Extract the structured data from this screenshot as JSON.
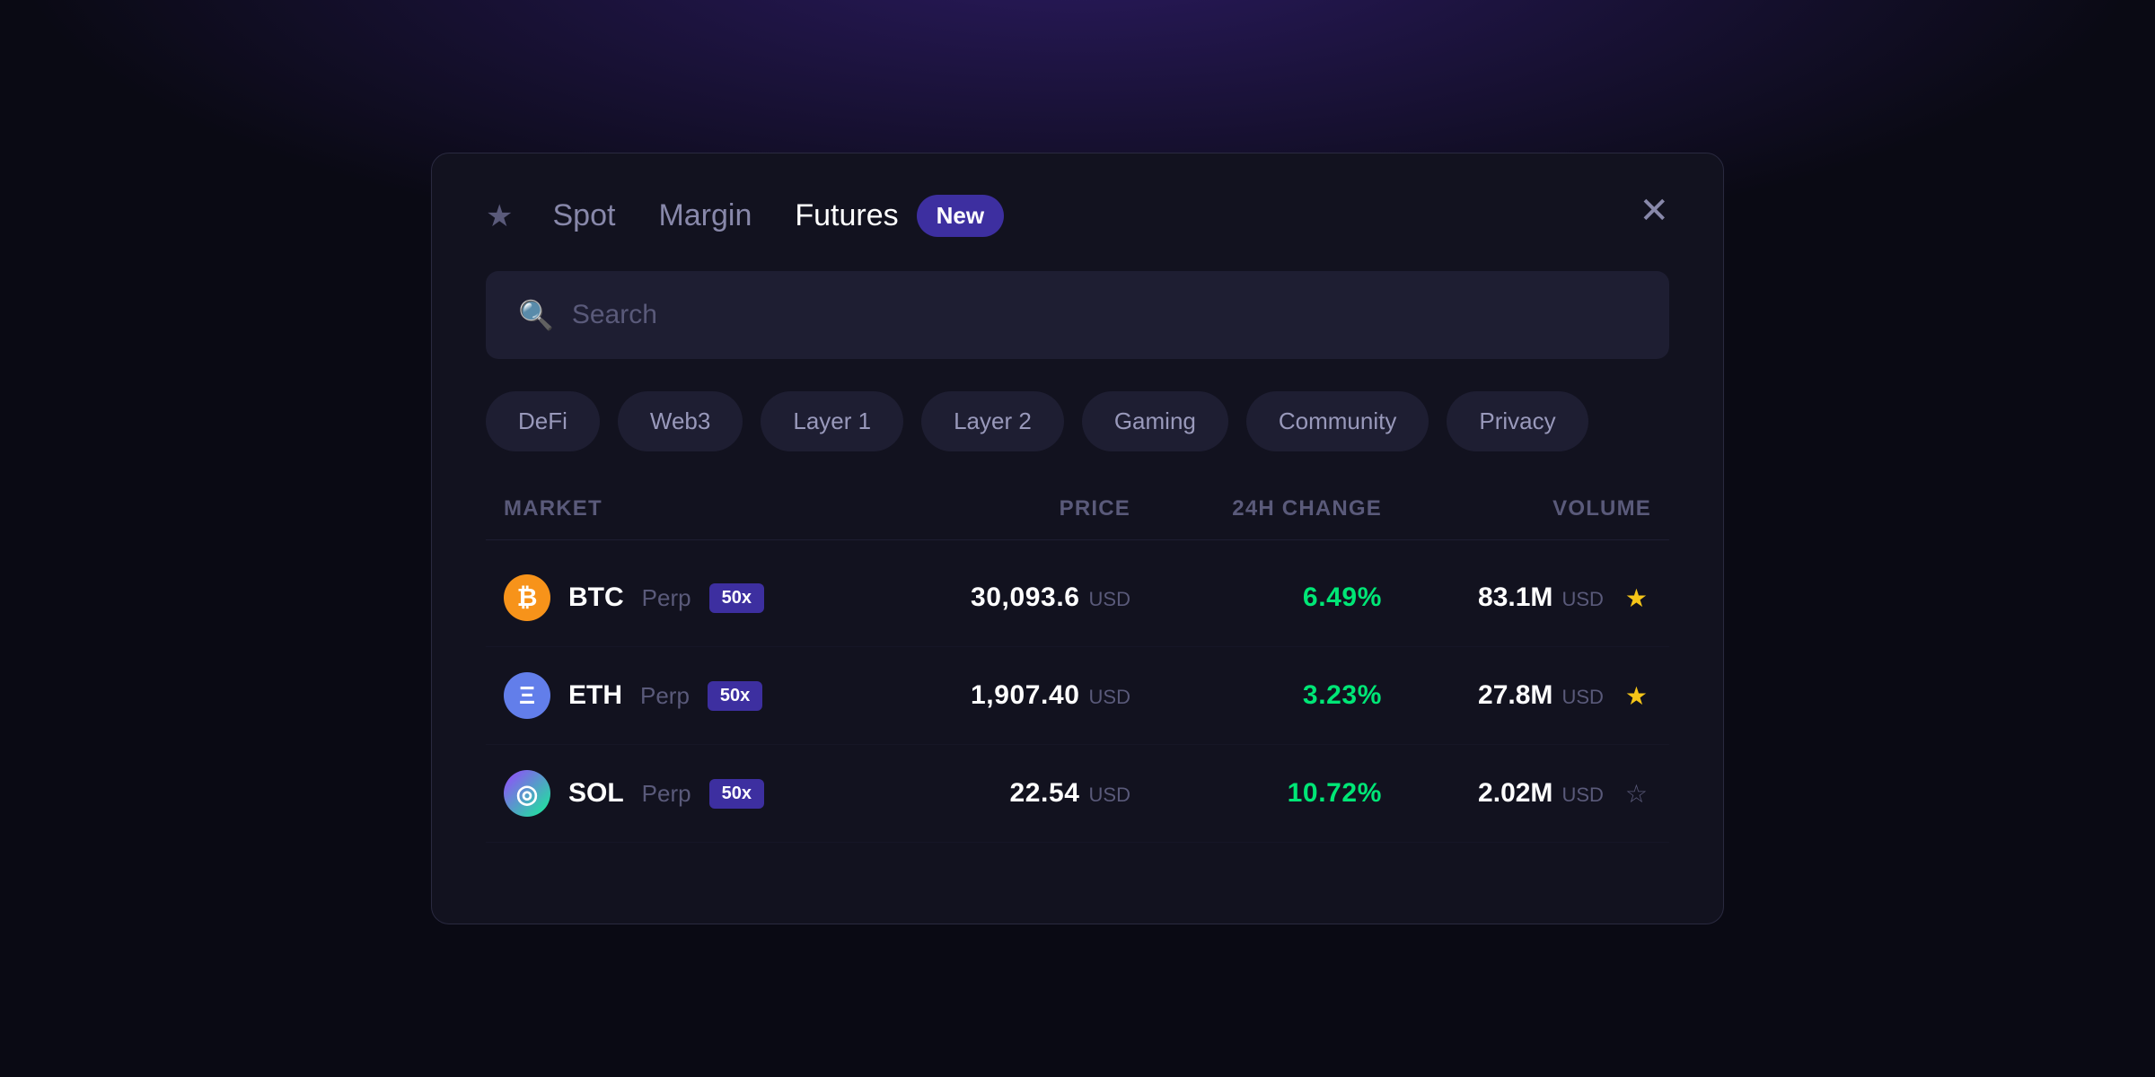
{
  "background": {
    "color": "#0a0a14"
  },
  "modal": {
    "tabs": [
      {
        "id": "spot",
        "label": "Spot",
        "active": false
      },
      {
        "id": "margin",
        "label": "Margin",
        "active": false
      },
      {
        "id": "futures",
        "label": "Futures",
        "active": true
      }
    ],
    "new_badge": "New",
    "close_label": "✕",
    "star_icon": "★",
    "search": {
      "placeholder": "Search"
    },
    "categories": [
      {
        "id": "defi",
        "label": "DeFi"
      },
      {
        "id": "web3",
        "label": "Web3"
      },
      {
        "id": "layer1",
        "label": "Layer 1"
      },
      {
        "id": "layer2",
        "label": "Layer 2"
      },
      {
        "id": "gaming",
        "label": "Gaming"
      },
      {
        "id": "community",
        "label": "Community"
      },
      {
        "id": "privacy",
        "label": "Privacy"
      }
    ],
    "table": {
      "headers": [
        {
          "id": "market",
          "label": "MARKET",
          "align": "left"
        },
        {
          "id": "price",
          "label": "Price",
          "align": "right"
        },
        {
          "id": "change",
          "label": "24H Change",
          "align": "right"
        },
        {
          "id": "volume",
          "label": "Volume",
          "align": "right"
        }
      ],
      "rows": [
        {
          "id": "btc",
          "symbol": "BTC",
          "type": "Perp",
          "leverage": "50x",
          "coin_letter": "₿",
          "coin_class": "btc",
          "price": "30,093.6",
          "price_currency": "USD",
          "change": "6.49%",
          "change_positive": true,
          "volume": "83.1M",
          "volume_currency": "USD",
          "starred": true
        },
        {
          "id": "eth",
          "symbol": "ETH",
          "type": "Perp",
          "leverage": "50x",
          "coin_letter": "Ξ",
          "coin_class": "eth",
          "price": "1,907.40",
          "price_currency": "USD",
          "change": "3.23%",
          "change_positive": true,
          "volume": "27.8M",
          "volume_currency": "USD",
          "starred": true
        },
        {
          "id": "sol",
          "symbol": "SOL",
          "type": "Perp",
          "leverage": "50x",
          "coin_letter": "◎",
          "coin_class": "sol",
          "price": "22.54",
          "price_currency": "USD",
          "change": "10.72%",
          "change_positive": true,
          "volume": "2.02M",
          "volume_currency": "USD",
          "starred": false
        }
      ]
    }
  }
}
